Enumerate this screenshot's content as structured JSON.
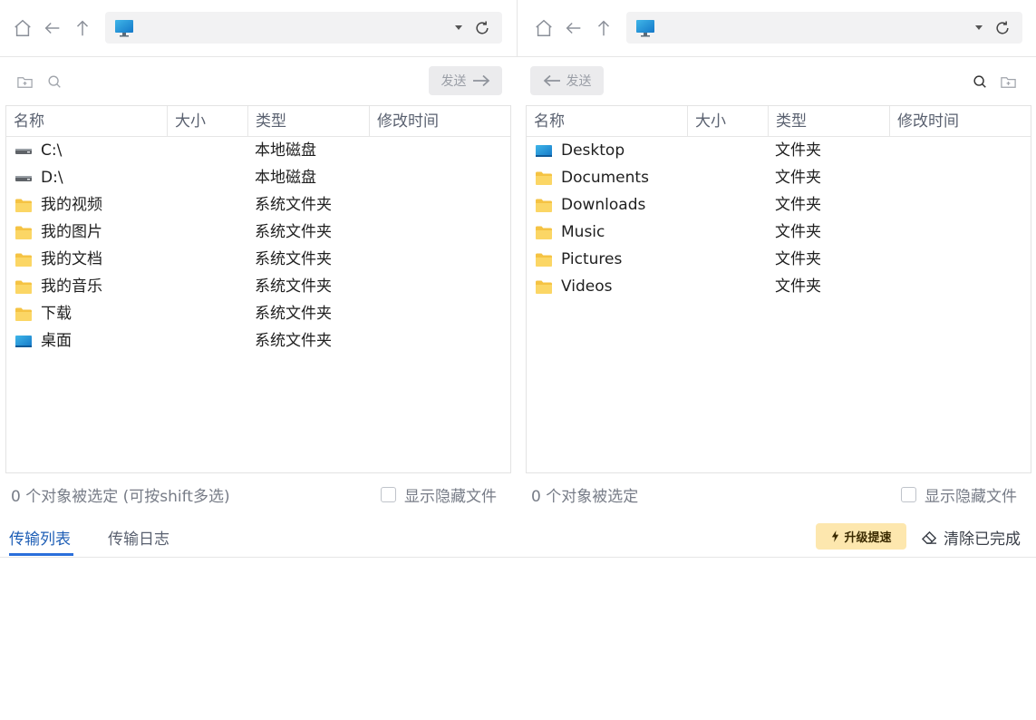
{
  "left_pane": {
    "send_label": "发送",
    "columns": [
      "名称",
      "大小",
      "类型",
      "修改时间"
    ],
    "rows": [
      {
        "name": "C:\\",
        "type": "本地磁盘",
        "icon": "drive-icon"
      },
      {
        "name": "D:\\",
        "type": "本地磁盘",
        "icon": "drive-icon"
      },
      {
        "name": "我的视频",
        "type": "系统文件夹",
        "icon": "folder-icon"
      },
      {
        "name": "我的图片",
        "type": "系统文件夹",
        "icon": "folder-icon"
      },
      {
        "name": "我的文档",
        "type": "系统文件夹",
        "icon": "folder-icon"
      },
      {
        "name": "我的音乐",
        "type": "系统文件夹",
        "icon": "folder-icon"
      },
      {
        "name": "下载",
        "type": "系统文件夹",
        "icon": "folder-icon"
      },
      {
        "name": "桌面",
        "type": "系统文件夹",
        "icon": "desktop-folder-icon"
      }
    ],
    "status": "0 个对象被选定 (可按shift多选)",
    "show_hidden_label": "显示隐藏文件"
  },
  "right_pane": {
    "send_label": "发送",
    "columns": [
      "名称",
      "大小",
      "类型",
      "修改时间"
    ],
    "rows": [
      {
        "name": "Desktop",
        "type": "文件夹",
        "icon": "desktop-folder-icon"
      },
      {
        "name": "Documents",
        "type": "文件夹",
        "icon": "folder-icon"
      },
      {
        "name": "Downloads",
        "type": "文件夹",
        "icon": "folder-icon"
      },
      {
        "name": "Music",
        "type": "文件夹",
        "icon": "folder-icon"
      },
      {
        "name": "Pictures",
        "type": "文件夹",
        "icon": "folder-icon"
      },
      {
        "name": "Videos",
        "type": "文件夹",
        "icon": "folder-icon"
      }
    ],
    "status": "0 个对象被选定",
    "show_hidden_label": "显示隐藏文件"
  },
  "bottom": {
    "tabs": [
      "传输列表",
      "传输日志"
    ],
    "active_tab": "传输列表",
    "upgrade_label": "升级提速",
    "clear_label": "清除已完成"
  },
  "colors": {
    "accent": "#2a6fdb",
    "folder": "#f5c343",
    "upgrade_bg": "#fde7ae"
  }
}
